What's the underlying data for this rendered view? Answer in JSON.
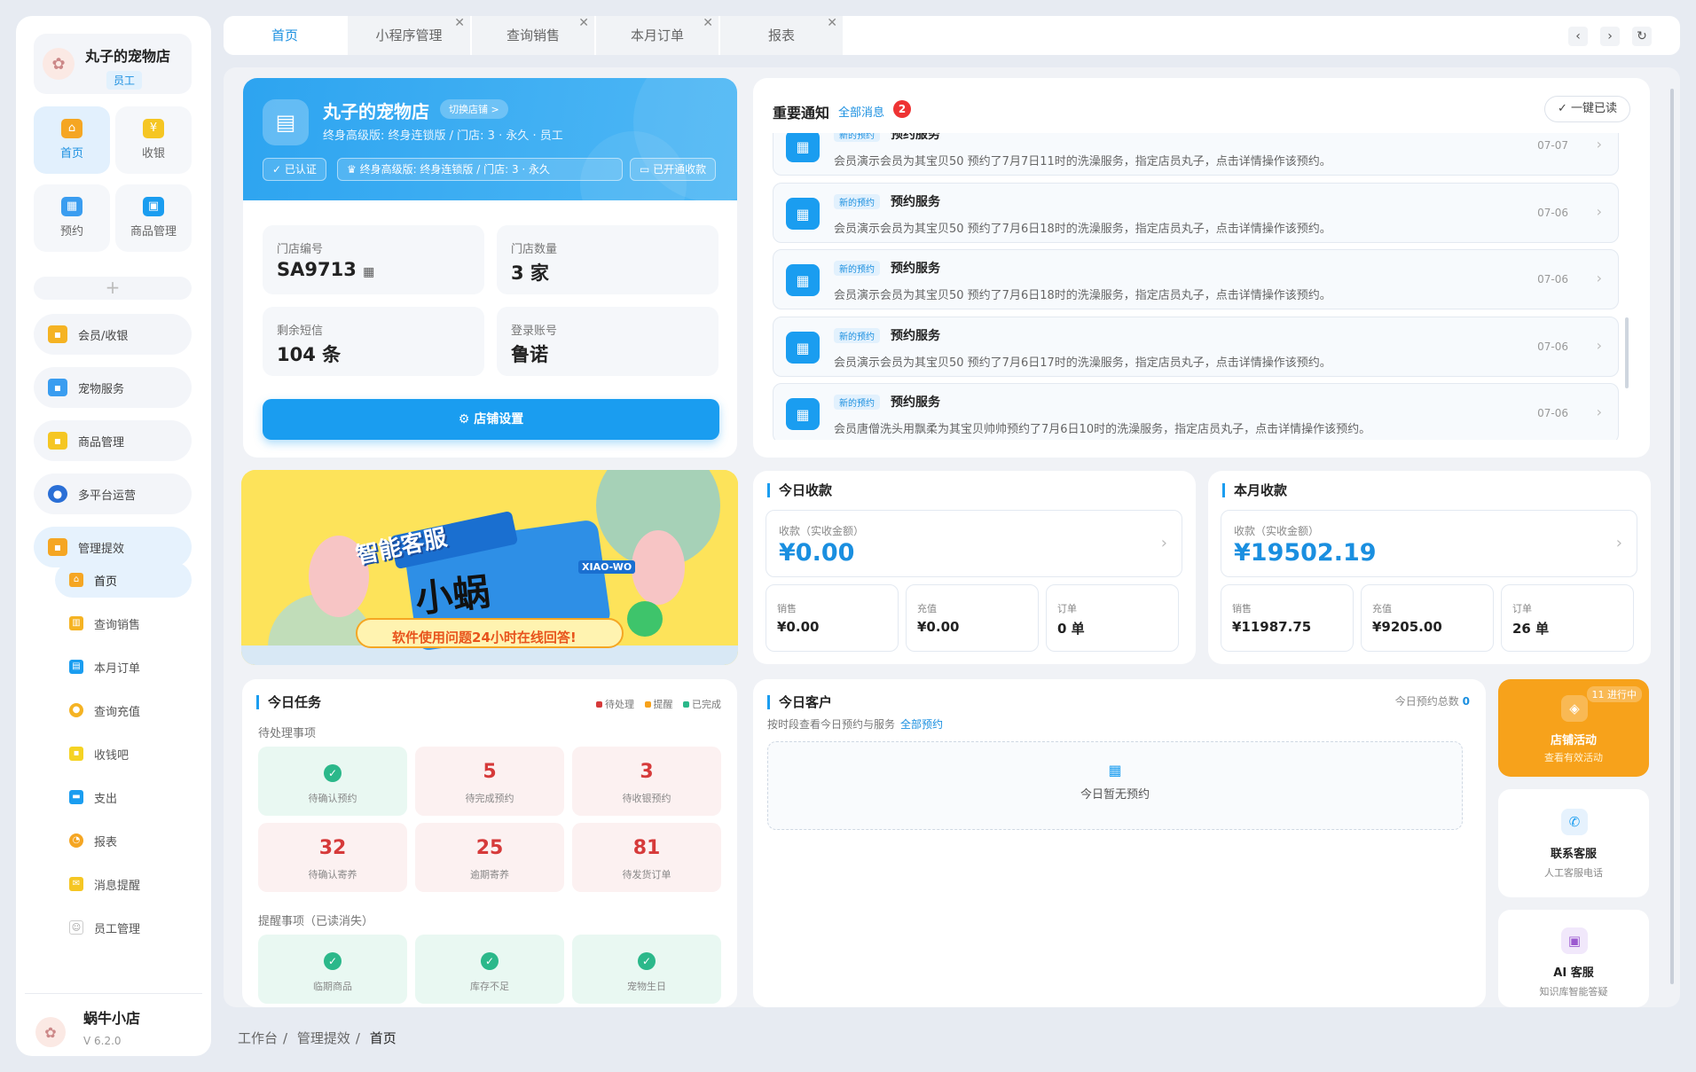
{
  "sidebar": {
    "store_name": "丸子的宠物店",
    "role": "员工",
    "quick": [
      {
        "label": "首页",
        "icon": "home-icon",
        "color": "#f5a623"
      },
      {
        "label": "收银",
        "icon": "cashier-icon",
        "color": "#f5c623"
      },
      {
        "label": "预约",
        "icon": "calendar-icon",
        "color": "#3a9df0"
      },
      {
        "label": "商品管理",
        "icon": "bag-icon",
        "color": "#1a9df0"
      }
    ],
    "groups": [
      {
        "label": "会员/收银"
      },
      {
        "label": "宠物服务"
      },
      {
        "label": "商品管理"
      },
      {
        "label": "多平台运营"
      },
      {
        "label": "管理提效"
      }
    ],
    "subitems": [
      {
        "label": "首页"
      },
      {
        "label": "查询销售"
      },
      {
        "label": "本月订单"
      },
      {
        "label": "查询充值"
      },
      {
        "label": "收钱吧"
      },
      {
        "label": "支出"
      },
      {
        "label": "报表"
      },
      {
        "label": "消息提醒"
      },
      {
        "label": "员工管理"
      }
    ],
    "footer_name": "蜗牛小店",
    "footer_version": "V 6.2.0"
  },
  "tabs": [
    {
      "label": "首页"
    },
    {
      "label": "小程序管理"
    },
    {
      "label": "查询销售"
    },
    {
      "label": "本月订单"
    },
    {
      "label": "报表"
    }
  ],
  "breadcrumb": [
    "工作台",
    "管理提效",
    "首页"
  ],
  "store": {
    "name": "丸子的宠物店",
    "switch_label": "切换店铺 >",
    "subtitle": "终身高级版: 终身连锁版 / 门店: 3 · 永久 · 员工",
    "chips": [
      "已认证",
      "终身高级版: 终身连锁版 / 门店: 3 · 永久",
      "已开通收款"
    ],
    "stats": [
      {
        "label": "门店编号",
        "value": "SA9713"
      },
      {
        "label": "门店数量",
        "value": "3 家"
      },
      {
        "label": "剩余短信",
        "value": "104 条"
      },
      {
        "label": "登录账号",
        "value": "鲁诺"
      }
    ],
    "settings_button": "店铺设置"
  },
  "notices": {
    "title": "重要通知",
    "all_label": "全部消息",
    "badge": "2",
    "read_all": "一键已读",
    "items": [
      {
        "tag": "新的预约",
        "type": "预约服务",
        "text": "会员演示会员为其宝贝50 预约了7月7日11时的洗澡服务，指定店员丸子，点击详情操作该预约。",
        "date": "07-07"
      },
      {
        "tag": "新的预约",
        "type": "预约服务",
        "text": "会员演示会员为其宝贝50 预约了7月6日18时的洗澡服务，指定店员丸子，点击详情操作该预约。",
        "date": "07-06"
      },
      {
        "tag": "新的预约",
        "type": "预约服务",
        "text": "会员演示会员为其宝贝50 预约了7月6日18时的洗澡服务，指定店员丸子，点击详情操作该预约。",
        "date": "07-06"
      },
      {
        "tag": "新的预约",
        "type": "预约服务",
        "text": "会员演示会员为其宝贝50 预约了7月6日17时的洗澡服务，指定店员丸子，点击详情操作该预约。",
        "date": "07-06"
      },
      {
        "tag": "新的预约",
        "type": "预约服务",
        "text": "会员唐僧洗头用飘柔为其宝贝帅帅预约了7月6日10时的洗澡服务，指定店员丸子，点击详情操作该预约。",
        "date": "07-06"
      }
    ]
  },
  "banner": {
    "title_top": "智能客服",
    "title_main": "小蜗",
    "badge": "XIAO-WO",
    "slogan": "软件使用问题24小时在线回答!"
  },
  "today_income": {
    "title": "今日收款",
    "main_label": "收款（实收金额）",
    "main_value": "¥0.00",
    "subs": [
      {
        "label": "销售",
        "value": "¥0.00"
      },
      {
        "label": "充值",
        "value": "¥0.00"
      },
      {
        "label": "订单",
        "value": "0 单"
      }
    ]
  },
  "month_income": {
    "title": "本月收款",
    "main_label": "收款（实收金额）",
    "main_value": "¥19502.19",
    "subs": [
      {
        "label": "销售",
        "value": "¥11987.75"
      },
      {
        "label": "充值",
        "value": "¥9205.00"
      },
      {
        "label": "订单",
        "value": "26 单"
      }
    ]
  },
  "tasks": {
    "title": "今日任务",
    "legend": [
      "待处理",
      "提醒",
      "已完成"
    ],
    "pending_label": "待处理事项",
    "pending": [
      {
        "value": "",
        "label": "待确认预约",
        "done": true
      },
      {
        "value": "5",
        "label": "待完成预约",
        "done": false
      },
      {
        "value": "3",
        "label": "待收银预约",
        "done": false
      },
      {
        "value": "32",
        "label": "待确认寄养",
        "done": false
      },
      {
        "value": "25",
        "label": "逾期寄养",
        "done": false
      },
      {
        "value": "81",
        "label": "待发货订单",
        "done": false
      }
    ],
    "remind_label": "提醒事项（已读消失）",
    "remind": [
      {
        "label": "临期商品"
      },
      {
        "label": "库存不足"
      },
      {
        "label": "宠物生日"
      }
    ]
  },
  "customers": {
    "title": "今日客户",
    "total_label": "今日预约总数",
    "total_value": "0",
    "subtitle": "按时段查看今日预约与服务",
    "all_link": "全部预约",
    "empty_text": "今日暂无预约"
  },
  "tiles": {
    "activity": {
      "badge": "11 进行中",
      "title": "店铺活动",
      "sub": "查看有效活动"
    },
    "support": {
      "title": "联系客服",
      "sub": "人工客服电话"
    },
    "ai": {
      "title": "AI 客服",
      "sub": "知识库智能答疑"
    }
  },
  "colors": {
    "accent": "#1a9df0",
    "danger": "#d63a3a",
    "success": "#2bb88a",
    "warning": "#f7a21b"
  }
}
